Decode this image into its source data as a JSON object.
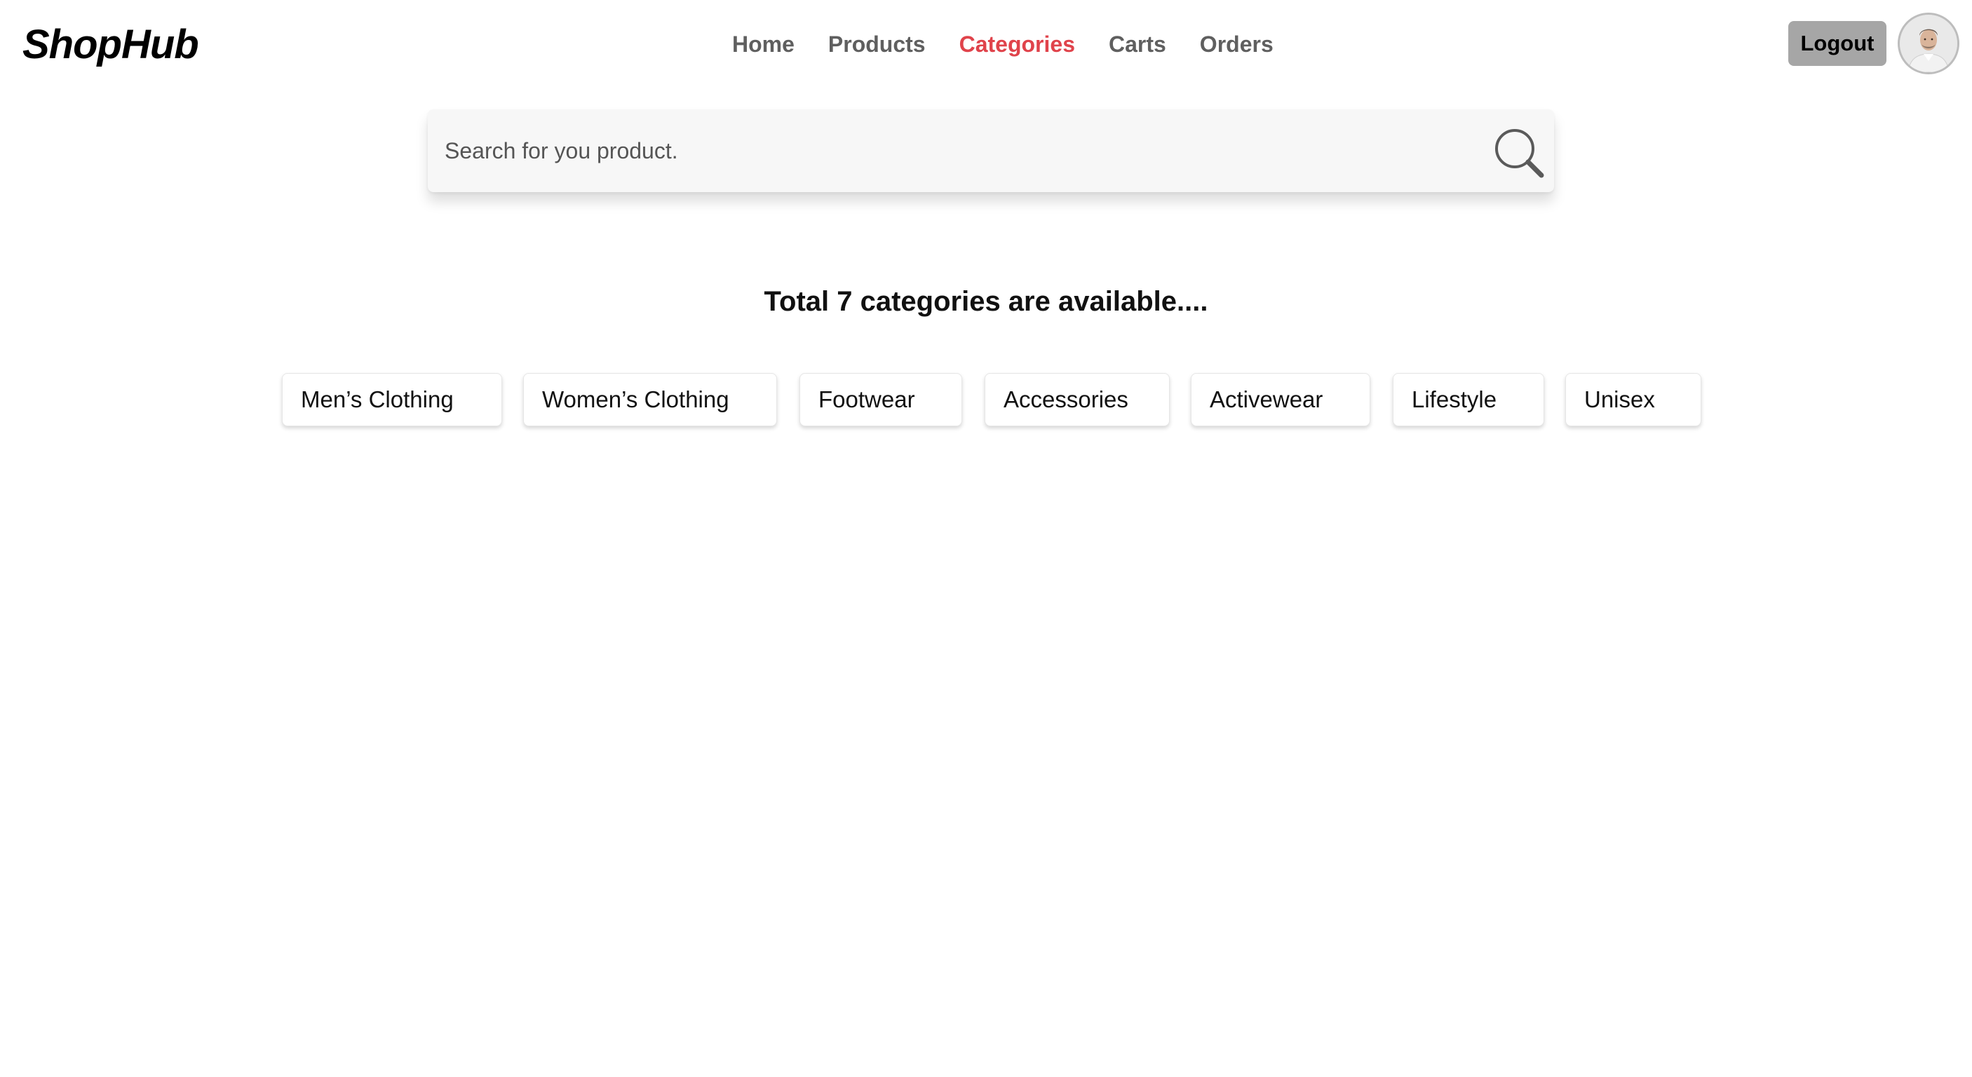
{
  "app": {
    "logo": "ShopHub"
  },
  "nav": {
    "items": [
      {
        "label": "Home",
        "active": false
      },
      {
        "label": "Products",
        "active": false
      },
      {
        "label": "Categories",
        "active": true
      },
      {
        "label": "Carts",
        "active": false
      },
      {
        "label": "Orders",
        "active": false
      }
    ],
    "active_color": "#e0434b",
    "color": "#5f5f5f"
  },
  "header": {
    "logout_label": "Logout",
    "avatar_icon": "user-avatar"
  },
  "search": {
    "placeholder": "Search for you product.",
    "value": "",
    "icon": "search-icon"
  },
  "main": {
    "heading": "Total 7 categories are available....",
    "categories": [
      "Men’s Clothing",
      "Women’s Clothing",
      "Footwear",
      "Accessories",
      "Activewear",
      "Lifestyle",
      "Unisex"
    ]
  }
}
